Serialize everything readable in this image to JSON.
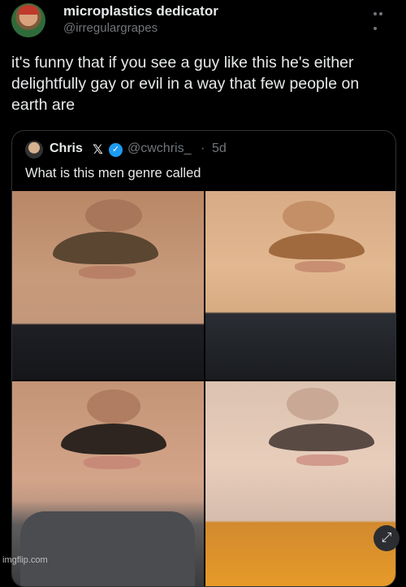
{
  "post": {
    "author_name": "microplastics dedicator",
    "author_handle": "@irregulargrapes",
    "text": "it's funny that if you see a guy like this he's either delightfully gay or evil in a way that few people on earth are"
  },
  "quote": {
    "author_name": "Chris",
    "x_glyph": "𝕏",
    "verified_glyph": "✓",
    "author_handle": "@cwchris_",
    "separator": "·",
    "time": "5d",
    "text": "What is this men genre called"
  },
  "media": {
    "images": [
      {
        "label": "mustache-photo-1"
      },
      {
        "label": "mustache-photo-2"
      },
      {
        "label": "mustache-photo-3"
      },
      {
        "label": "mustache-photo-4"
      }
    ],
    "expand_glyph": "⤢"
  },
  "watermark": "imgflip.com",
  "icons": [
    "more-options-icon",
    "verified-badge-icon",
    "expand-icon"
  ],
  "colors": {
    "background": "#000000",
    "text": "#e7e9ea",
    "muted": "#71767b",
    "verified": "#1d9bf0",
    "border": "#2f3336"
  }
}
